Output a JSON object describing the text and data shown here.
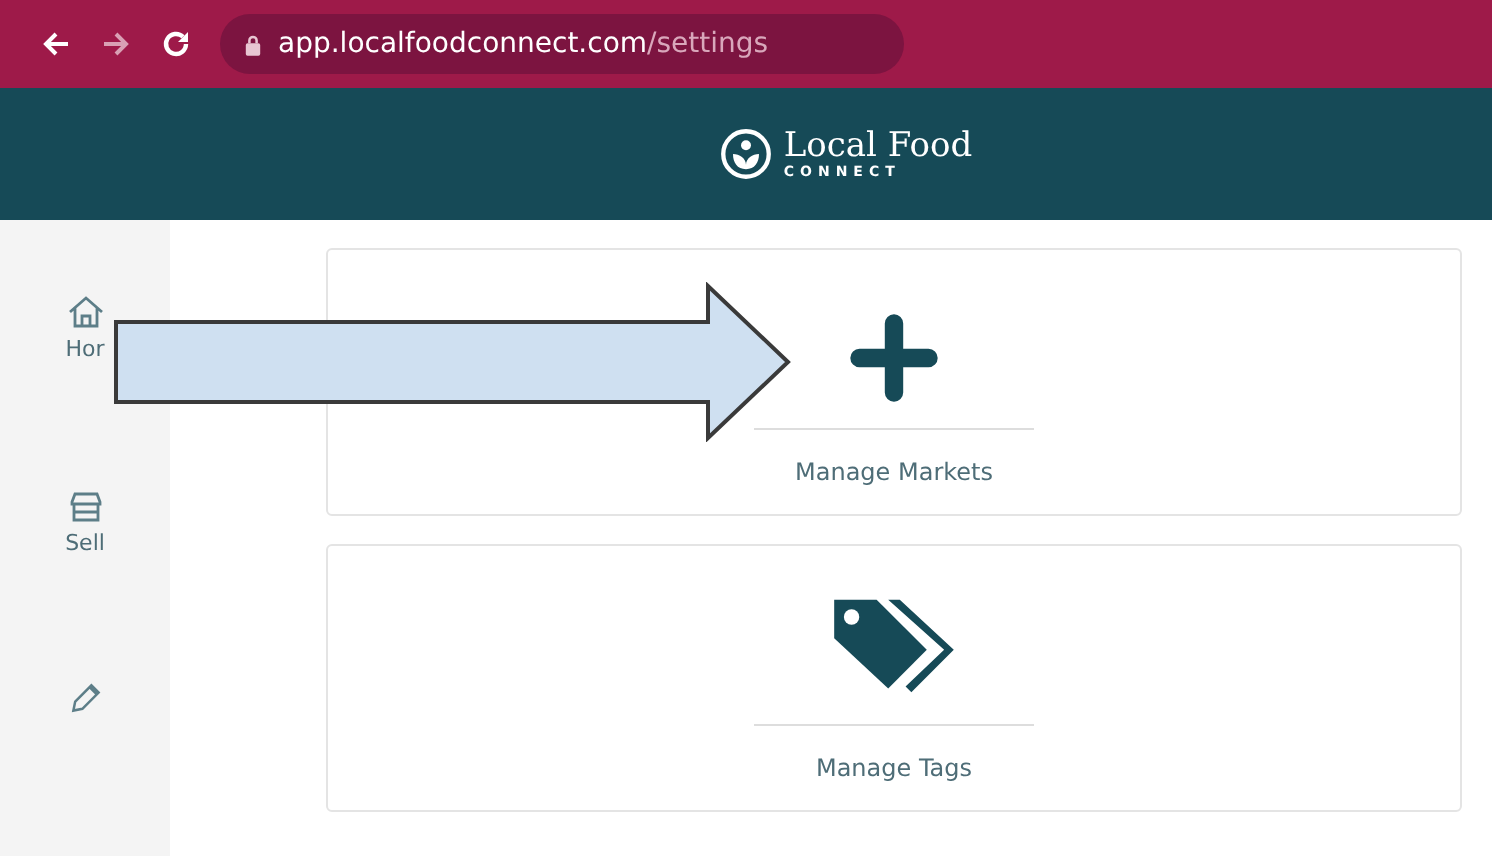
{
  "browser": {
    "url_host": "app.localfoodconnect.com",
    "url_path": "/settings"
  },
  "header": {
    "logo_title": "Local Food",
    "logo_subtitle": "CONNECT"
  },
  "sidebar": {
    "items": [
      {
        "kind": "home",
        "label": "Hor"
      },
      {
        "kind": "sell",
        "label": "Sell"
      },
      {
        "kind": "edit"
      }
    ]
  },
  "cards": [
    {
      "kind": "plus",
      "label": "Manage Markets"
    },
    {
      "kind": "tags",
      "label": "Manage Tags"
    }
  ],
  "annotation": {
    "kind": "arrow"
  }
}
